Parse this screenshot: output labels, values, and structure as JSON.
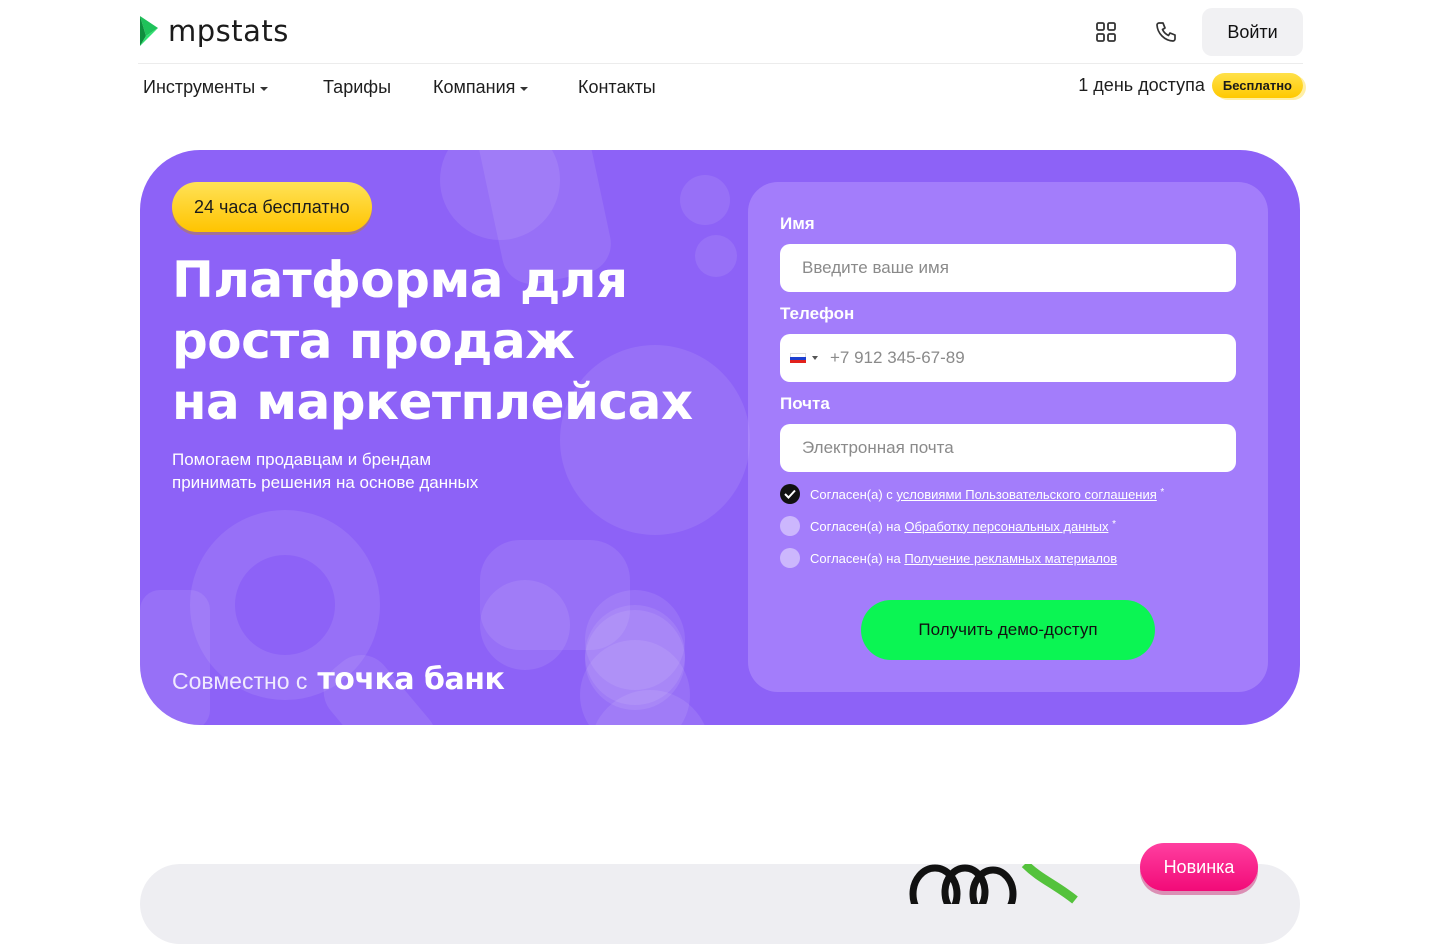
{
  "header": {
    "logo_text": "mpstats",
    "login_label": "Войти",
    "icons": [
      "apps-grid-icon",
      "phone-icon"
    ]
  },
  "nav": {
    "items": [
      {
        "label": "Инструменты",
        "has_dropdown": true
      },
      {
        "label": "Тарифы",
        "has_dropdown": false
      },
      {
        "label": "Компания",
        "has_dropdown": true
      },
      {
        "label": "Контакты",
        "has_dropdown": false
      }
    ],
    "trial_text": "1 день доступа",
    "trial_badge": "Бесплатно"
  },
  "hero": {
    "chip": "24 часа бесплатно",
    "title_line1": "Платформа для",
    "title_line2": "роста продаж",
    "title_line3": "на маркетплейсах",
    "subtitle_line1": "Помогаем продавцам и брендам",
    "subtitle_line2": "принимать решения на основе данных",
    "partner_lead": "Совместно с",
    "partner_name": "точка банк"
  },
  "form": {
    "name_label": "Имя",
    "name_placeholder": "Введите ваше имя",
    "phone_label": "Телефон",
    "phone_placeholder": "+7 912 345-67-89",
    "email_label": "Почта",
    "email_placeholder": "Электронная почта",
    "agreements": [
      {
        "prefix": "Согласен(а) с",
        "link": "условиями Пользовательского соглашения",
        "required": "*",
        "checked": true
      },
      {
        "prefix": "Согласен(а) на",
        "link": "Обработку персональных данных",
        "required": "*",
        "checked": false
      },
      {
        "prefix": "Согласен(а) на",
        "link": "Получение рекламных материалов",
        "required": "",
        "checked": false
      }
    ],
    "submit_label": "Получить демо-доступ"
  },
  "badge_new": "Новинка",
  "colors": {
    "hero_bg": "#8d62f7",
    "cta": "#0bf553",
    "yellow": "#ffd21f",
    "pink": "#f20a78",
    "logo_green": "#1fc25a"
  }
}
